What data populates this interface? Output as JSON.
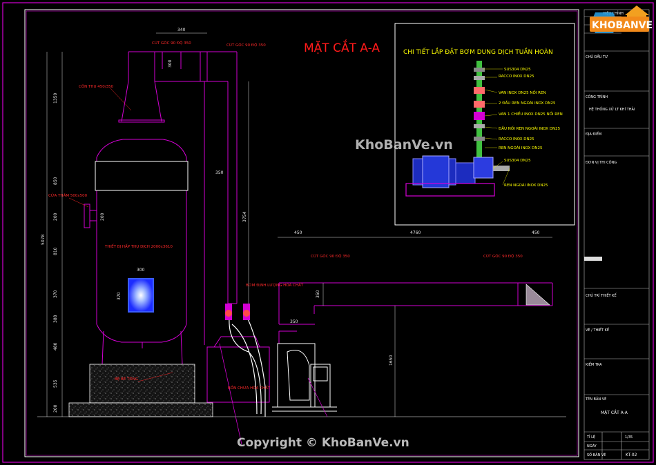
{
  "title": "MẶT CẮT A-A",
  "detail_title": "CHI TIẾT LẮP ĐẶT BƠM DUNG DỊCH TUẦN HOÀN",
  "detail_labels": [
    "SUS304 DN25",
    "RACCO INOX DN25",
    "VAN INOX DN25 NỐI REN",
    "2 ĐẦU REN NGOÀI INOX DN25",
    "VAN 1 CHIỀU INOX DN25 NỐI REN",
    "ĐẦU NỐI REN NGOÀI INOX DN25",
    "RACCO INOX DN25",
    "REN NGOÀI INOX DN25",
    "SUS304 DN25",
    "REN NGOÀI INOX DN25"
  ],
  "labels": {
    "elbow_top_left": "CÚT GÓC 90 ĐỘ 350",
    "elbow_top_right": "CÚT GÓC 90 ĐỘ 350",
    "reducer": "CÔN THU 450/350",
    "tower_body": "THIẾT BỊ HẤP THỤ DỊCH 2000x3610",
    "inspection_door": "CỬA THĂM 500x500",
    "dosing": "BƠM ĐỊNH LƯỢNG HÓA CHẤT",
    "concrete_base": "BỆ BÊ TÔNG",
    "solution_tank": "BỒN CHỨA HÓA CHẤT",
    "elbow_mid": "CÚT GÓC 90 ĐỘ 350",
    "elbow_right": "CÚT GÓC 90 ĐỘ 350"
  },
  "dimensions": {
    "top_width": "340",
    "top_drop": "300",
    "d1350": "1350",
    "d850": "850",
    "d200": "200",
    "d810": "810",
    "d370": "370",
    "d388": "388",
    "d480": "480",
    "d535": "535",
    "d200b": "200",
    "total_height": "5078",
    "duct_350": "350",
    "duct_3754": "3754",
    "window_300": "300",
    "window_370": "370",
    "inspection_200": "200",
    "span_450a": "450",
    "span_4760": "4760",
    "span_450b": "450",
    "fan_350": "350",
    "duct_350b": "350",
    "height_1650": "1650"
  },
  "title_block": {
    "header": "HIỆU CHỈNH",
    "client_label": "CHỦ ĐẦU TƯ",
    "project_label": "CÔNG TRÌNH",
    "project_value": "HỆ THỐNG XỬ LÝ KHÍ THẢI",
    "address_label": "ĐỊA ĐIỂM",
    "unit_label": "ĐƠN VỊ THI CÔNG",
    "design_label": "CHỦ TRÌ THIẾT KẾ",
    "drawn_label": "VẼ / THIẾT KẾ",
    "check_label": "KIỂM TRA",
    "drawing_name_label": "TÊN BẢN VẼ",
    "drawing_name": "MẶT CẮT A-A",
    "scale_label": "TỈ LỆ",
    "scale_value": "1/35",
    "date_label": "NGÀY",
    "sheet_label": "SỐ BẢN VẼ",
    "sheet_value": "KT-02"
  },
  "watermark": "KhoBanVe.vn",
  "copyright": "Copyright © KhoBanVe.vn",
  "logo_text": "KHOBANVE",
  "colors": {
    "frame": "#d400d4",
    "title": "#ff1a1a",
    "dim": "#e0e0e0",
    "label": "#ffff00",
    "pipe_green": "#40c040"
  }
}
